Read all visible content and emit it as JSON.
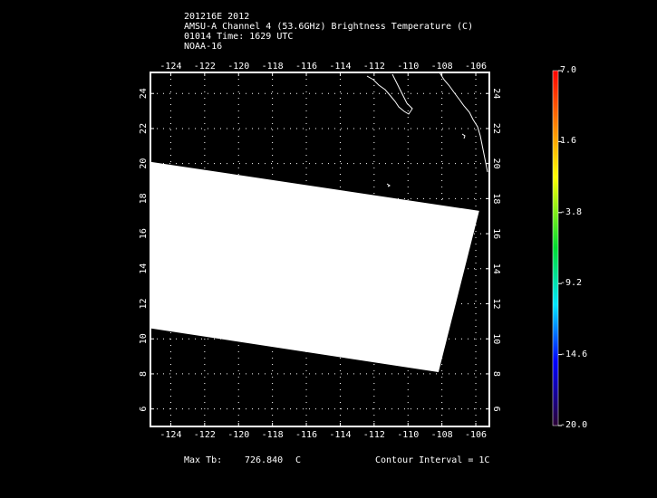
{
  "header": {
    "line1": "201216E 2012",
    "line2": "AMSU-A Channel 4 (53.6GHz) Brightness Temperature (C)",
    "line3": "01014 Time: 1629 UTC",
    "line4": "NOAA-16"
  },
  "map": {
    "lon_range": [
      -125.2,
      -105.2
    ],
    "lat_range": [
      5,
      25.2
    ],
    "lon_ticks": [
      "-124",
      "-122",
      "-120",
      "-118",
      "-116",
      "-114",
      "-112",
      "-110",
      "-108",
      "-106"
    ],
    "lat_ticks": [
      "6",
      "8",
      "10",
      "12",
      "14",
      "16",
      "18",
      "20",
      "22",
      "24"
    ],
    "swath_color": "#ffffff",
    "swath_corners_lonlat": [
      [
        -125.2,
        20.1
      ],
      [
        -105.8,
        17.3
      ],
      [
        -108.2,
        8.1
      ],
      [
        -125.2,
        10.6
      ]
    ],
    "grid": "dotted"
  },
  "colorbar": {
    "labels": [
      "7.0",
      "1.6",
      "-3.8",
      "-9.2",
      "-14.6",
      "-20.0"
    ],
    "max": 7.0,
    "min": -20.0
  },
  "footer": {
    "max_tb_label": "Max Tb:",
    "max_tb_value": "726.840",
    "max_tb_unit": "C",
    "contour": "Contour Interval = 1C"
  }
}
